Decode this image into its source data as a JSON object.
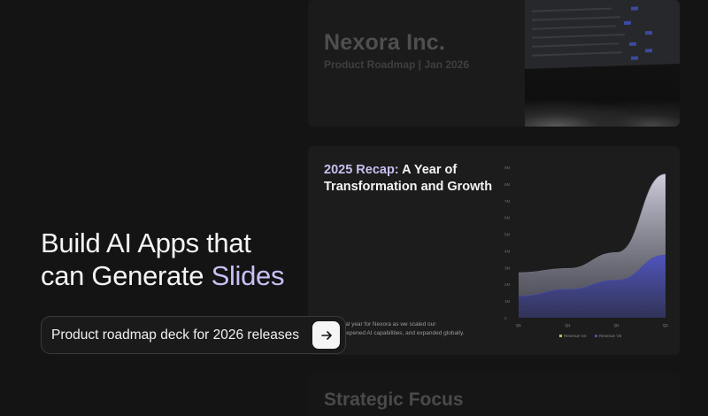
{
  "hero": {
    "title_line1": "Build AI Apps that",
    "title_line2_prefix": "can Generate ",
    "title_line2_accent": "Slides"
  },
  "prompt": {
    "value": "Product roadmap deck for 2026 releases",
    "send_icon": "arrow-right-icon"
  },
  "slides": {
    "top": {
      "title": "Nexora Inc.",
      "subtitle": "Product Roadmap | Jan 2026"
    },
    "mid": {
      "title_accent": "2025 Recap:",
      "title_rest": " A Year of Transformation and Growth",
      "body_line1": "s a pivotal year for Nexora as we scaled our",
      "body_line2": "cture, deepened AI capabilities, and expanded globally."
    },
    "bottom": {
      "title": "Strategic Focus"
    }
  },
  "colors": {
    "accent": "#c9bff5",
    "series_24": "#7a7d8e",
    "series_25": "#4a4fa8"
  },
  "chart_data": {
    "type": "area",
    "categories": [
      "Q1",
      "Q1",
      "Q1",
      "Q1"
    ],
    "y_ticks": [
      "0",
      "1M",
      "2M",
      "3M",
      "4M",
      "5M",
      "6M",
      "7M",
      "8M",
      "9M"
    ],
    "ylim": [
      0,
      9000000
    ],
    "series": [
      {
        "name": "Revenue '24",
        "values": [
          2700000,
          2950000,
          3900000,
          8600000
        ]
      },
      {
        "name": "Revenue '25",
        "values": [
          1300000,
          1700000,
          2250000,
          3750000
        ]
      }
    ],
    "legend_position": "bottom",
    "grid": false
  }
}
